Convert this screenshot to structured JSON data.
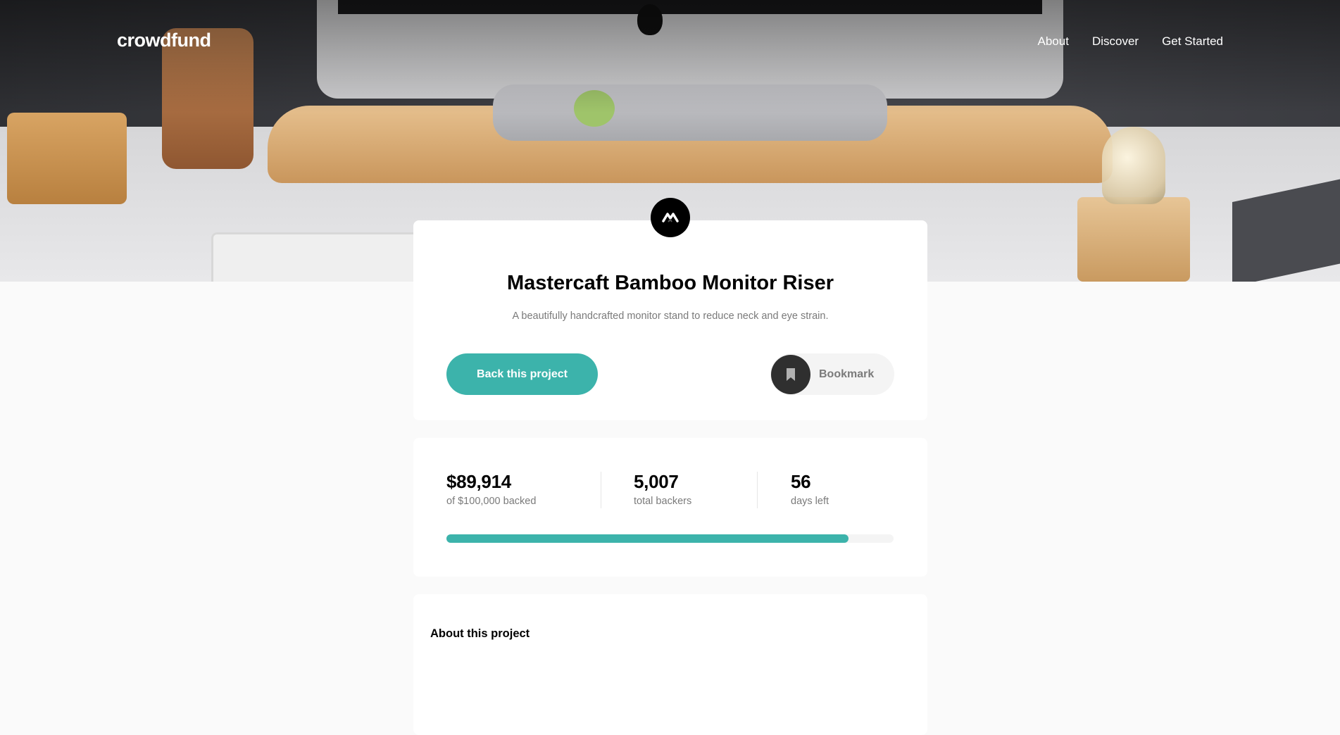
{
  "brand": "crowdfund",
  "nav": {
    "items": [
      "About",
      "Discover",
      "Get Started"
    ]
  },
  "project": {
    "title": "Mastercaft Bamboo Monitor Riser",
    "description": "A beautifully handcrafted monitor stand to reduce neck and eye strain.",
    "back_label": "Back this project",
    "bookmark_label": "Bookmark"
  },
  "stats": {
    "raised": {
      "value": "$89,914",
      "label": "of $100,000 backed"
    },
    "backers": {
      "value": "5,007",
      "label": "total backers"
    },
    "days": {
      "value": "56",
      "label": "days left"
    },
    "progress_fraction": 0.899
  },
  "about": {
    "title": "About this project"
  },
  "colors": {
    "accent": "#3cb3ab",
    "dark": "#2f2f2f",
    "muted": "#7a7a7a"
  },
  "icons": {
    "project_logo": "mastercraft-logo-icon",
    "bookmark": "bookmark-icon"
  }
}
